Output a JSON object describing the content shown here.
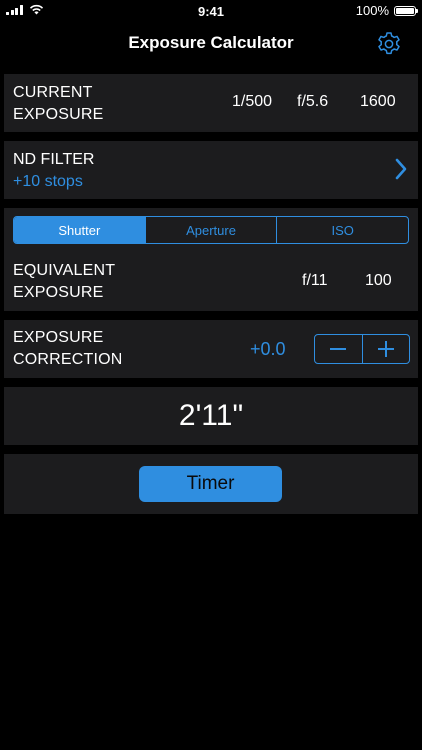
{
  "status_bar": {
    "time": "9:41",
    "battery_percent": "100%",
    "battery_level": 1.0
  },
  "nav": {
    "title": "Exposure Calculator",
    "settings_icon": "gear-icon"
  },
  "current_exposure": {
    "label_line1": "CURRENT",
    "label_line2": "EXPOSURE",
    "shutter": "1/500",
    "aperture": "f/5.6",
    "iso": "1600"
  },
  "nd_filter": {
    "label": "ND FILTER",
    "value": "+10 stops",
    "chevron_icon": "chevron-right-icon"
  },
  "equivalent": {
    "tabs": [
      {
        "label": "Shutter",
        "active": true
      },
      {
        "label": "Aperture",
        "active": false
      },
      {
        "label": "ISO",
        "active": false
      }
    ],
    "label_line1": "EQUIVALENT",
    "label_line2": "EXPOSURE",
    "aperture": "f/11",
    "iso": "100"
  },
  "correction": {
    "label_line1": "EXPOSURE",
    "label_line2": "CORRECTION",
    "value": "+0.0",
    "minus_icon": "minus-icon",
    "plus_icon": "plus-icon"
  },
  "result": {
    "time": "2'11\""
  },
  "timer": {
    "label": "Timer"
  },
  "colors": {
    "accent": "#2f8ee0",
    "card_background": "#1c1c1e",
    "page_background": "#000000"
  }
}
